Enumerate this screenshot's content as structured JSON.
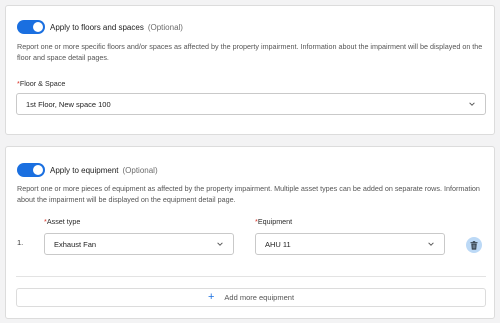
{
  "floors_section": {
    "toggle_label": "Apply to floors and spaces",
    "toggle_optional": "(Optional)",
    "toggle_on": true,
    "description": "Report one or more specific floors and/or spaces as affected by the property impairment. Information about the impairment will be displayed on the floor and space detail pages.",
    "field_required_mark": "*",
    "field_label": "Floor & Space",
    "field_value": "1st Floor, New space 100"
  },
  "equipment_section": {
    "toggle_label": "Apply to equipment",
    "toggle_optional": "(Optional)",
    "toggle_on": true,
    "description": "Report one or more pieces of equipment as affected by the property impairment. Multiple asset types can be added on separate rows. Information about the impairment will be displayed on the equipment detail page.",
    "asset_type_required_mark": "*",
    "asset_type_label": "Asset type",
    "equipment_required_mark": "*",
    "equipment_label": "Equipment",
    "rows": [
      {
        "number": "1.",
        "asset_type": "Exhaust Fan",
        "equipment": "AHU 11"
      }
    ],
    "add_button_icon": "+",
    "add_button_label": "Add more equipment"
  },
  "colors": {
    "accent": "#1a6fe0",
    "required": "#d93025",
    "delete_button_bg": "#bcd9f6"
  }
}
